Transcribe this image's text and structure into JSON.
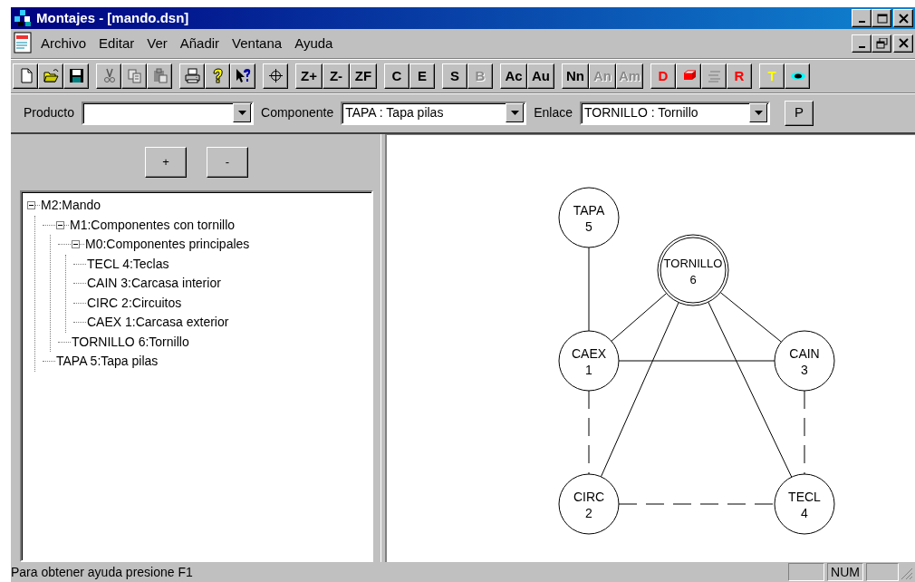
{
  "window": {
    "title": "Montajes - [mando.dsn]"
  },
  "menu": [
    {
      "label": "Archivo"
    },
    {
      "label": "Editar"
    },
    {
      "label": "Ver"
    },
    {
      "label": "Añadir"
    },
    {
      "label": "Ventana"
    },
    {
      "label": "Ayuda"
    }
  ],
  "toolbar": [
    [
      {
        "kind": "new",
        "disabled": false
      },
      {
        "kind": "open",
        "disabled": false
      },
      {
        "kind": "save",
        "disabled": false
      }
    ],
    [
      {
        "kind": "cut",
        "disabled": true
      },
      {
        "kind": "copy",
        "disabled": true
      },
      {
        "kind": "paste",
        "disabled": true
      }
    ],
    [
      {
        "kind": "print",
        "disabled": false
      },
      {
        "kind": "help",
        "disabled": false
      },
      {
        "kind": "contexthelp",
        "disabled": false
      }
    ],
    [
      {
        "kind": "crosshair",
        "disabled": false
      }
    ],
    [
      {
        "kind": "text",
        "label": "Z+",
        "disabled": false
      },
      {
        "kind": "text",
        "label": "Z-",
        "disabled": false
      },
      {
        "kind": "text",
        "label": "ZF",
        "disabled": false
      }
    ],
    [
      {
        "kind": "text",
        "label": "C",
        "disabled": false
      },
      {
        "kind": "text",
        "label": "E",
        "disabled": false
      }
    ],
    [
      {
        "kind": "text",
        "label": "S",
        "disabled": false
      },
      {
        "kind": "text",
        "label": "B",
        "disabled": true
      }
    ],
    [
      {
        "kind": "text",
        "label": "Ac",
        "disabled": false
      },
      {
        "kind": "text",
        "label": "Au",
        "disabled": false
      }
    ],
    [
      {
        "kind": "text",
        "label": "Nn",
        "disabled": false
      },
      {
        "kind": "text",
        "label": "An",
        "disabled": true
      },
      {
        "kind": "text",
        "label": "Am",
        "disabled": true
      }
    ],
    [
      {
        "kind": "text",
        "label": "D",
        "disabled": false,
        "color": "#ff0000"
      },
      {
        "kind": "block",
        "disabled": false
      },
      {
        "kind": "lines",
        "disabled": true
      },
      {
        "kind": "text",
        "label": "R",
        "disabled": false,
        "color": "#ff0000"
      }
    ],
    [
      {
        "kind": "text",
        "label": "T",
        "disabled": false,
        "color": "#ffff00"
      },
      {
        "kind": "eye",
        "disabled": false
      }
    ]
  ],
  "selectors": [
    {
      "label": "Producto"
    },
    {
      "label": "Componente",
      "value": "TAPA : Tapa pilas"
    },
    {
      "label": "Enlace",
      "value": "TORNILLO : Tornillo"
    }
  ],
  "p_button": "P",
  "tree_buttons": [
    "+",
    "-"
  ],
  "tree": [
    {
      "label": "M2:Mando",
      "expanded": true,
      "children": [
        {
          "label": "M1:Componentes con tornillo",
          "expanded": true,
          "children": [
            {
              "label": "M0:Componentes principales",
              "expanded": true,
              "children": [
                {
                  "label": "TECL 4:Teclas"
                },
                {
                  "label": "CAIN 3:Carcasa interior"
                },
                {
                  "label": "CIRC 2:Circuitos"
                },
                {
                  "label": "CAEX 1:Carcasa exterior"
                }
              ]
            },
            {
              "label": "TORNILLO 6:Tornillo"
            }
          ]
        },
        {
          "label": "TAPA 5:Tapa pilas"
        }
      ]
    }
  ],
  "graph": {
    "nodes": [
      {
        "label": "TAPA",
        "number": "5",
        "kind": "single"
      },
      {
        "label": "TORNILLO",
        "number": "6",
        "kind": "double"
      },
      {
        "label": "CAEX",
        "number": "1",
        "kind": "single"
      },
      {
        "label": "CAIN",
        "number": "3",
        "kind": "single"
      },
      {
        "label": "CIRC",
        "number": "2",
        "kind": "single"
      },
      {
        "label": "TECL",
        "number": "4",
        "kind": "single"
      }
    ]
  },
  "status_bar": {
    "text": "Para obtener ayuda presione F1",
    "indicator": "NUM"
  }
}
